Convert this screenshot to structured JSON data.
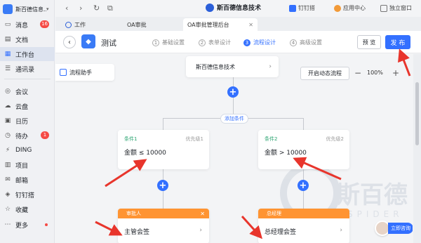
{
  "sidebar": {
    "org_name": "斯百德信息...",
    "items": [
      {
        "label": "消息",
        "badge": "16",
        "icon": "chat-icon"
      },
      {
        "label": "文档",
        "icon": "doc-icon"
      },
      {
        "label": "工作台",
        "icon": "grid-icon",
        "active": true
      },
      {
        "label": "通讯录",
        "icon": "contacts-icon"
      },
      {
        "label": "会议",
        "icon": "meeting-icon"
      },
      {
        "label": "云盘",
        "icon": "cloud-icon"
      },
      {
        "label": "日历",
        "icon": "calendar-icon"
      },
      {
        "label": "待办",
        "badge": "1",
        "icon": "todo-icon"
      },
      {
        "label": "DING",
        "icon": "ding-icon"
      },
      {
        "label": "项目",
        "icon": "project-icon"
      },
      {
        "label": "邮箱",
        "icon": "mail-icon"
      },
      {
        "label": "钉钉搭",
        "icon": "build-icon"
      },
      {
        "label": "收藏",
        "icon": "star-icon"
      },
      {
        "label": "更多",
        "icon": "more-icon"
      }
    ]
  },
  "topbar": {
    "brand": "斯百德信息技术",
    "links": [
      "钉钉搭",
      "应用中心",
      "独立窗口"
    ]
  },
  "tabs": [
    "工作",
    "OA审批",
    "OA审批管理后台"
  ],
  "header": {
    "title": "测试",
    "steps": [
      {
        "num": "1",
        "label": "基础设置"
      },
      {
        "num": "2",
        "label": "表单设计"
      },
      {
        "num": "3",
        "label": "流程设计",
        "active": true
      },
      {
        "num": "4",
        "label": "高级设置"
      }
    ],
    "preview": "预 览",
    "publish": "发 布"
  },
  "canvas": {
    "assistant": "流程助手",
    "start_node": "斯百德信息技术",
    "dynamic_flow": "开启动态流程",
    "zoom": "100%",
    "add_condition": "添加条件",
    "conditions": [
      {
        "name": "条件1",
        "priority": "优先级1",
        "expr": "金额 ≤ 10000"
      },
      {
        "name": "条件2",
        "priority": "优先级2",
        "expr": "金额 > 10000"
      }
    ],
    "approvers": [
      {
        "role": "审批人",
        "value": "主管会签"
      },
      {
        "role": "总经理",
        "value": "总经理会签"
      }
    ],
    "watermark": {
      "text": "斯百德",
      "sub": "SPIDER"
    },
    "consult": "立即咨询"
  },
  "colors": {
    "accent": "#3370ff",
    "condition": "#2ba471",
    "approver": "#ff9432",
    "arrow": "#e8352c"
  }
}
